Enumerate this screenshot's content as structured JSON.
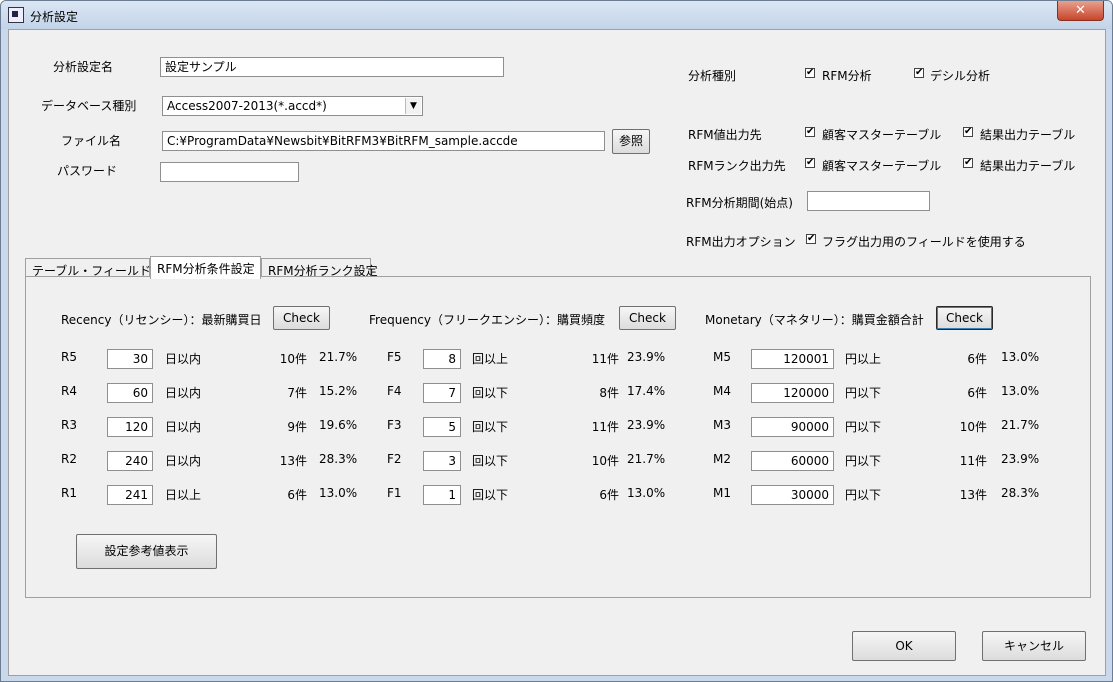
{
  "window": {
    "title": "分析設定",
    "close_label": "✕"
  },
  "form": {
    "name_label": "分析設定名",
    "name_value": "設定サンプル",
    "dbtype_label": "データベース種別",
    "dbtype_value": "Access2007-2013(*.accd*)",
    "file_label": "ファイル名",
    "file_value": "C:¥ProgramData¥Newsbit¥BitRFM3¥BitRFM_sample.accde",
    "browse_label": "参照",
    "password_label": "パスワード",
    "password_value": ""
  },
  "right": {
    "kind_label": "分析種別",
    "kind_rfm": "RFM分析",
    "kind_decile": "デシル分析",
    "value_out_label": "RFM値出力先",
    "rank_out_label": "RFMランク出力先",
    "master_table": "顧客マスターテーブル",
    "result_table": "結果出力テーブル",
    "period_label": "RFM分析期間(始点)",
    "period_value": "",
    "option_label": "RFM出力オプション",
    "option_text": "フラグ出力用のフィールドを使用する"
  },
  "tabs": [
    "テーブル・フィールド設定",
    "RFM分析条件設定",
    "RFM分析ランク設定"
  ],
  "headers": {
    "recency": "Recency（リセンシー）：最新購買日",
    "frequency": "Frequency（フリークエンシー）：購買頻度",
    "monetary": "Monetary（マネタリー）：購買金額合計",
    "check": "Check"
  },
  "recency": [
    {
      "label": "R5",
      "value": "30",
      "unit": "日以内",
      "count": "10件",
      "pct": "21.7%"
    },
    {
      "label": "R4",
      "value": "60",
      "unit": "日以内",
      "count": "7件",
      "pct": "15.2%"
    },
    {
      "label": "R3",
      "value": "120",
      "unit": "日以内",
      "count": "9件",
      "pct": "19.6%"
    },
    {
      "label": "R2",
      "value": "240",
      "unit": "日以内",
      "count": "13件",
      "pct": "28.3%"
    },
    {
      "label": "R1",
      "value": "241",
      "unit": "日以上",
      "count": "6件",
      "pct": "13.0%"
    }
  ],
  "frequency": [
    {
      "label": "F5",
      "value": "8",
      "unit": "回以上",
      "count": "11件",
      "pct": "23.9%"
    },
    {
      "label": "F4",
      "value": "7",
      "unit": "回以下",
      "count": "8件",
      "pct": "17.4%"
    },
    {
      "label": "F3",
      "value": "5",
      "unit": "回以下",
      "count": "11件",
      "pct": "23.9%"
    },
    {
      "label": "F2",
      "value": "3",
      "unit": "回以下",
      "count": "10件",
      "pct": "21.7%"
    },
    {
      "label": "F1",
      "value": "1",
      "unit": "回以下",
      "count": "6件",
      "pct": "13.0%"
    }
  ],
  "monetary": [
    {
      "label": "M5",
      "value": "120001",
      "unit": "円以上",
      "count": "6件",
      "pct": "13.0%"
    },
    {
      "label": "M4",
      "value": "120000",
      "unit": "円以下",
      "count": "6件",
      "pct": "13.0%"
    },
    {
      "label": "M3",
      "value": "90000",
      "unit": "円以下",
      "count": "10件",
      "pct": "21.7%"
    },
    {
      "label": "M2",
      "value": "60000",
      "unit": "円以下",
      "count": "11件",
      "pct": "23.9%"
    },
    {
      "label": "M1",
      "value": "30000",
      "unit": "円以下",
      "count": "13件",
      "pct": "28.3%"
    }
  ],
  "buttons": {
    "reference": "設定参考値表示",
    "ok": "OK",
    "cancel": "キャンセル"
  }
}
